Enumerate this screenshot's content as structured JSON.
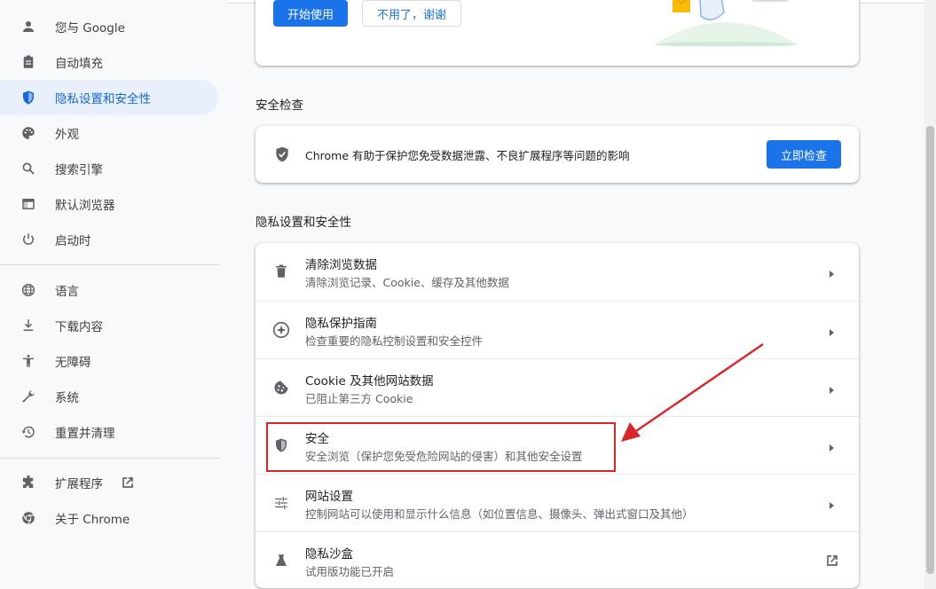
{
  "sidebar": {
    "items": [
      {
        "label": "您与 Google",
        "icon": "person-icon"
      },
      {
        "label": "自动填充",
        "icon": "clipboard-icon"
      },
      {
        "label": "隐私设置和安全性",
        "icon": "shield-icon",
        "active": true
      },
      {
        "label": "外观",
        "icon": "palette-icon"
      },
      {
        "label": "搜索引擎",
        "icon": "search-icon"
      },
      {
        "label": "默认浏览器",
        "icon": "browser-window-icon"
      },
      {
        "label": "启动时",
        "icon": "power-icon"
      },
      {
        "label": "语言",
        "icon": "globe-icon"
      },
      {
        "label": "下载内容",
        "icon": "download-icon"
      },
      {
        "label": "无障碍",
        "icon": "accessibility-icon"
      },
      {
        "label": "系统",
        "icon": "wrench-icon"
      },
      {
        "label": "重置并清理",
        "icon": "history-icon"
      },
      {
        "label": "扩展程序",
        "icon": "puzzle-icon"
      },
      {
        "label": "关于 Chrome",
        "icon": "chrome-logo-icon"
      }
    ]
  },
  "promo": {
    "start_label": "开始使用",
    "decline_label": "不用了，谢谢"
  },
  "safety_check": {
    "title": "安全检查",
    "description": "Chrome 有助于保护您免受数据泄露、不良扩展程序等问题的影响",
    "button_label": "立即检查"
  },
  "privacy": {
    "title": "隐私设置和安全性",
    "rows": [
      {
        "title": "清除浏览数据",
        "subtitle": "清除浏览记录、Cookie、缓存及其他数据",
        "icon": "trash-icon"
      },
      {
        "title": "隐私保护指南",
        "subtitle": "检查重要的隐私控制设置和安全控件",
        "icon": "compass-icon"
      },
      {
        "title": "Cookie 及其他网站数据",
        "subtitle": "已阻止第三方 Cookie",
        "icon": "cookie-icon"
      },
      {
        "title": "安全",
        "subtitle": "安全浏览（保护您免受危险网站的侵害）和其他安全设置",
        "icon": "shield-icon"
      },
      {
        "title": "网站设置",
        "subtitle": "控制网站可以使用和显示什么信息（如位置信息、摄像头、弹出式窗口及其他）",
        "icon": "tune-icon"
      },
      {
        "title": "隐私沙盒",
        "subtitle": "试用版功能已开启",
        "icon": "flask-icon"
      }
    ]
  },
  "colors": {
    "accent": "#1a73e8",
    "active_bg": "#e8f0fe",
    "annotation": "#d9262c"
  }
}
